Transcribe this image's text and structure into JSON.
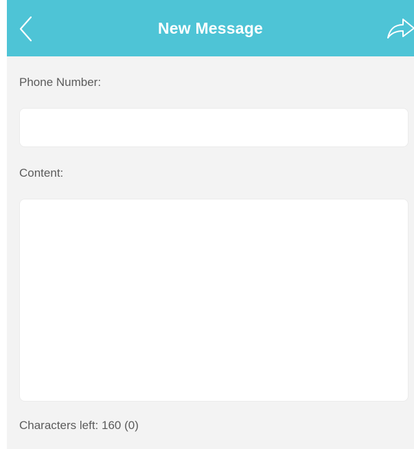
{
  "header": {
    "title": "New Message",
    "back_icon": "chevron-left-icon",
    "send_icon": "send-arrow-icon"
  },
  "form": {
    "phone_label": "Phone Number:",
    "phone_value": "",
    "phone_placeholder": "",
    "content_label": "Content:",
    "content_value": "",
    "content_placeholder": "",
    "characters_left_text": "Characters left: 160 (0)"
  },
  "colors": {
    "header_bg": "#4ec4d6",
    "page_bg": "#f3f3f3",
    "header_text": "#ffffff"
  }
}
